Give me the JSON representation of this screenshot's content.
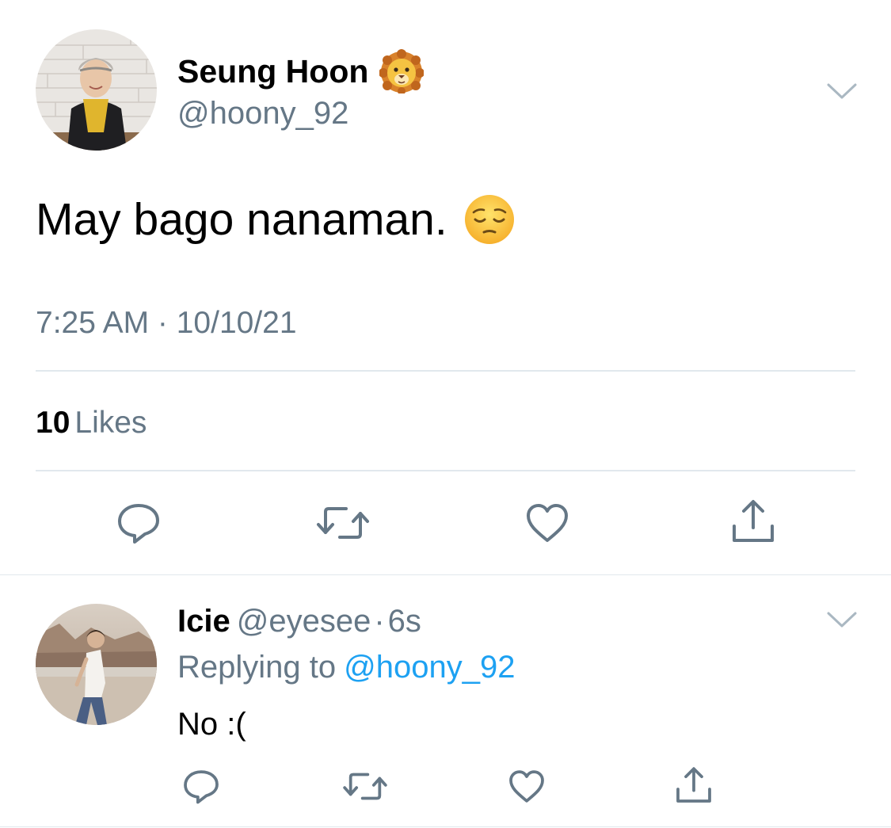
{
  "main_tweet": {
    "author_name": "Seung Hoon",
    "author_emoji": "lion-face-emoji",
    "author_handle": "@hoony_92",
    "text": "May bago nanaman.",
    "text_emoji": "pensive-face-emoji",
    "timestamp": "7:25 AM · 10/10/21",
    "likes_count": "10",
    "likes_label": "Likes",
    "actions": [
      "reply-icon",
      "retweet-icon",
      "like-icon",
      "share-icon"
    ]
  },
  "reply": {
    "author_name": "Icie",
    "author_handle": "@eyesee",
    "separator": "·",
    "time": "6s",
    "replying_to_label": "Replying to",
    "replying_to_mention": "@hoony_92",
    "text": "No :(",
    "actions": [
      "reply-icon",
      "retweet-icon",
      "like-icon",
      "share-icon"
    ]
  },
  "colors": {
    "text_primary": "#000000",
    "text_secondary": "#657786",
    "link": "#1da1f2",
    "icon": "#657786",
    "divider": "#e1e8ed"
  }
}
